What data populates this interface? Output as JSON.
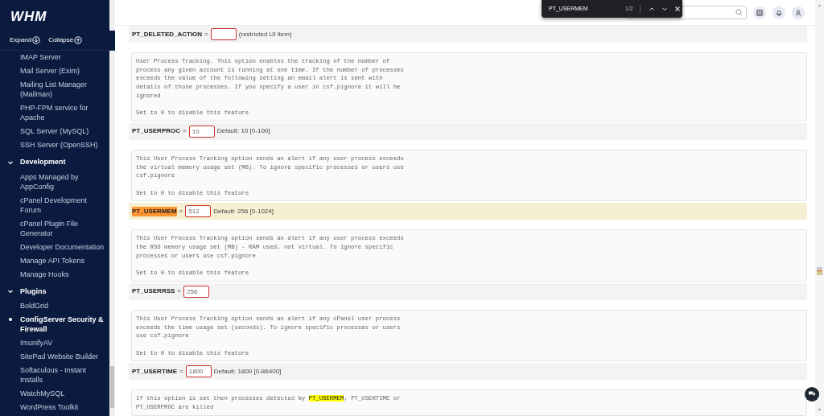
{
  "sidebar": {
    "logo": "WHM",
    "expand_label": "Expand",
    "collapse_label": "Collapse",
    "sections": [
      {
        "items": [
          {
            "label": "IMAP Server",
            "selected": false
          },
          {
            "label": "Mail Server (Exim)",
            "selected": false
          },
          {
            "label": "Mailing List Manager (Mailman)",
            "selected": false
          },
          {
            "label": "PHP-FPM service for Apache",
            "selected": false
          },
          {
            "label": "SQL Server (MySQL)",
            "selected": false
          },
          {
            "label": "SSH Server (OpenSSH)",
            "selected": false
          }
        ]
      },
      {
        "title": "Development",
        "expanded": true,
        "items": [
          {
            "label": "Apps Managed by AppConfig",
            "selected": false
          },
          {
            "label": "cPanel Development Forum",
            "selected": false
          },
          {
            "label": "cPanel Plugin File Generator",
            "selected": false
          },
          {
            "label": "Developer Documentation",
            "selected": false
          },
          {
            "label": "Manage API Tokens",
            "selected": false
          },
          {
            "label": "Manage Hooks",
            "selected": false
          }
        ]
      },
      {
        "title": "Plugins",
        "expanded": true,
        "items": [
          {
            "label": "BoldGrid",
            "selected": false
          },
          {
            "label": "ConfigServer Security & Firewall",
            "selected": true
          },
          {
            "label": "ImunifyAV",
            "selected": false
          },
          {
            "label": "SitePad Website Builder",
            "selected": false
          },
          {
            "label": "Softaculous - Instant Installs",
            "selected": false
          },
          {
            "label": "WatchMySQL",
            "selected": false
          },
          {
            "label": "WordPress Toolkit",
            "selected": false
          }
        ]
      }
    ]
  },
  "find_bar": {
    "query": "PT_USERMEM",
    "count": "1/2"
  },
  "options": [
    {
      "name": "PT_DELETED_ACTION",
      "current_match": false,
      "separator": "=",
      "row_highlighted": false,
      "note": "(restricted UI item)"
    },
    {
      "description": [
        [
          {
            "text": "User Process Tracking. This option enables the tracking of the number of\nprocess any given account is running at one time. If the number of processes\nexceeds the value of the following setting an email alert is sent with\ndetails of those processes. If you specify a user in csf.pignore it will be\nignored",
            "match": false
          }
        ],
        [
          {
            "text": "Set to 0 to disable this feature",
            "match": false
          }
        ]
      ],
      "name": "PT_USERPROC",
      "current_match": false,
      "separator": "=",
      "row_highlighted": false,
      "value": "10",
      "note": "Default: 10 [0-100]"
    },
    {
      "description": [
        [
          {
            "text": "This User Process Tracking option sends an alert if any user process exceeds\nthe virtual memory usage set (MB). To ignore specific processes or users use\ncsf.pignore",
            "match": false
          }
        ],
        [
          {
            "text": "Set to 0 to disable this feature",
            "match": false
          }
        ]
      ],
      "name": "PT_USERMEM",
      "current_match": true,
      "separator": "=",
      "row_highlighted": true,
      "value": "512",
      "note": "Default: 256 [0-1024]"
    },
    {
      "description": [
        [
          {
            "text": "This User Process Tracking option sends an alert if any user process exceeds\nthe RSS memory usage set (MB) - RAM used, not virtual. To ignore specific\nprocesses or users use csf.pignore",
            "match": false
          }
        ],
        [
          {
            "text": "Set to 0 to disable this feature",
            "match": false
          }
        ]
      ],
      "name": "PT_USERRSS",
      "current_match": false,
      "separator": "=",
      "row_highlighted": false,
      "value": "256"
    },
    {
      "description": [
        [
          {
            "text": "This User Process Tracking option sends an alert if any cPanel user process\nexceeds the time usage set (seconds). To ignore specific processes or users\nuse csf.pignore",
            "match": false
          }
        ],
        [
          {
            "text": "Set to 0 to disable this feature",
            "match": false
          }
        ]
      ],
      "name": "PT_USERTIME",
      "current_match": false,
      "separator": "=",
      "row_highlighted": false,
      "value": "1800",
      "note": "Default: 1800 [0-86400]"
    },
    {
      "description": [
        [
          {
            "text": "If this option is set then processes detected by ",
            "match": false
          },
          {
            "text": "PT_USERMEM",
            "match": true
          },
          {
            "text": ", PT_USERTIME or\nPT_USERPROC are killed",
            "match": false
          }
        ]
      ]
    }
  ]
}
